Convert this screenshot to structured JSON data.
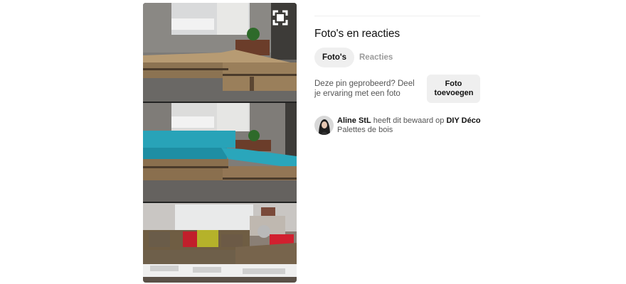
{
  "pin": {
    "expand_icon": "expand-icon"
  },
  "comments": {
    "title": "Foto's en reacties",
    "tabs": [
      {
        "label": "Foto's",
        "active": true
      },
      {
        "label": "Reacties",
        "active": false
      }
    ],
    "tried_prompt": "Deze pin geprobeerd? Deel je ervaring met een foto",
    "add_photo_label": "Foto toevoegen"
  },
  "save_info": {
    "user": "Aline StL",
    "middle_text": "heeft dit bewaard op",
    "board": "DIY Déco",
    "board_section": "Palettes de bois"
  },
  "colors": {
    "accent_inactive": "#9b9b9b",
    "button_bg": "#efefef",
    "cushion_teal": "#28a3b8"
  }
}
